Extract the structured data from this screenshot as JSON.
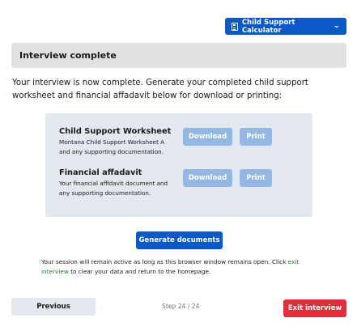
{
  "calculator_button": {
    "label": "Child Support Calculator",
    "icon": "calculator-icon",
    "chevron_icon": "chevron-down-icon"
  },
  "header": {
    "title": "Interview complete"
  },
  "intro_text": "Your interview is now complete. Generate your completed child support worksheet and financial affadavit below for download or printing:",
  "documents": [
    {
      "title": "Child Support Worksheet",
      "description": "Montana Child Support Worksheet A and any supporting documentation.",
      "download_label": "Download",
      "print_label": "Print"
    },
    {
      "title": "Financial affadavit",
      "description": "Your financial affidavit document and any supporting documentation.",
      "download_label": "Download",
      "print_label": "Print"
    }
  ],
  "generate_button": {
    "label": "Generate documents"
  },
  "session_note": {
    "before_link": "Your session will remain active as long as this browser window remains open. Click ",
    "link_text": "exit interview",
    "after_link": " to clear your data and return to the homepage."
  },
  "footer": {
    "previous_label": "Previous",
    "step_text": "Step 24 / 24",
    "exit_label": "Exit interview"
  },
  "colors": {
    "primary": "#0b58c7",
    "disabled_button": "#93b8e4",
    "danger": "#e52d3e",
    "panel": "#e3e8ef",
    "link": "#1f7a28"
  }
}
